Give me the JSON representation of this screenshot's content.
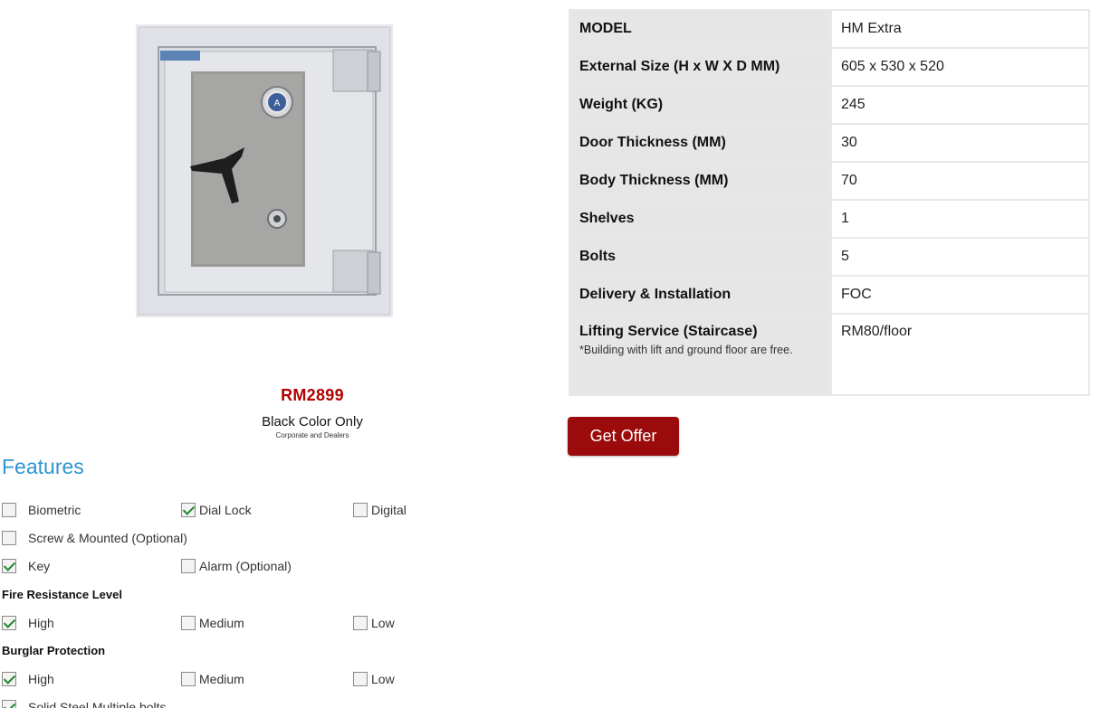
{
  "product": {
    "price": "RM2899",
    "color_note": "Black Color Only",
    "color_sub": "Corporate and Dealers"
  },
  "features": {
    "title": "Features",
    "rows": [
      [
        {
          "label": "Biometric",
          "checked": false
        },
        {
          "label": "Dial Lock",
          "checked": true
        },
        {
          "label": "Digital",
          "checked": false
        }
      ],
      [
        {
          "label": "Screw & Mounted (Optional)",
          "checked": false
        }
      ],
      [
        {
          "label": "Key",
          "checked": true
        },
        {
          "label": "Alarm (Optional)",
          "checked": false
        }
      ]
    ],
    "fire": {
      "heading": "Fire Resistance Level",
      "options": [
        {
          "label": "High",
          "checked": true
        },
        {
          "label": "Medium",
          "checked": false
        },
        {
          "label": "Low",
          "checked": false
        }
      ]
    },
    "burglar": {
      "heading": "Burglar Protection",
      "options": [
        {
          "label": "High",
          "checked": true
        },
        {
          "label": "Medium",
          "checked": false
        },
        {
          "label": "Low",
          "checked": false
        }
      ]
    },
    "extra": {
      "label": "Solid Steel Multiple bolts",
      "checked": true
    }
  },
  "specs": [
    {
      "key": "MODEL",
      "value": "HM Extra"
    },
    {
      "key": "External Size (H x W X D MM)",
      "value": "605 x 530 x 520"
    },
    {
      "key": "Weight (KG)",
      "value": "245"
    },
    {
      "key": "Door Thickness (MM)",
      "value": "30"
    },
    {
      "key": "Body Thickness (MM)",
      "value": "70"
    },
    {
      "key": "Shelves",
      "value": "1"
    },
    {
      "key": "Bolts",
      "value": "5"
    },
    {
      "key": "Delivery & Installation",
      "value": "FOC"
    },
    {
      "key": "Lifting Service (Staircase)",
      "note": "*Building with lift and ground floor are free.",
      "value": "RM80/floor"
    }
  ],
  "cta": {
    "label": "Get Offer"
  },
  "colors": {
    "accent_red": "#9b0b0b",
    "price_red": "#b30000",
    "features_blue": "#2f94cf",
    "check_green": "#1f8a2a"
  }
}
